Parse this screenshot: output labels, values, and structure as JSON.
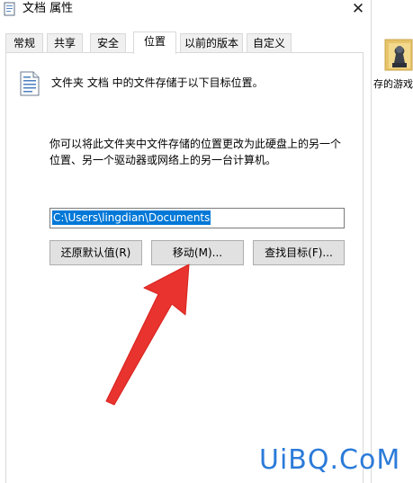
{
  "window": {
    "title": "文档 属性",
    "close_glyph": "✕"
  },
  "tabs": [
    {
      "label": "常规",
      "active": false
    },
    {
      "label": "共享",
      "active": false
    },
    {
      "label": "安全",
      "active": false
    },
    {
      "label": "位置",
      "active": true
    },
    {
      "label": "以前的版本",
      "active": false
    },
    {
      "label": "自定义",
      "active": false
    }
  ],
  "location_panel": {
    "heading": "文件夹 文档 中的文件存储于以下目标位置。",
    "description_lines": [
      "你可以将此文件夹中文件存储的位置更改为此硬盘上的另一个",
      "位置、另一个驱动器或网络上的另一台计算机。"
    ],
    "path_value": "C:\\Users\\lingdian\\Documents",
    "buttons": {
      "restore_default": "还原默认值(R)",
      "move": "移动(M)...",
      "find_target": "查找目标(F)..."
    }
  },
  "desktop": {
    "icon_label": "存的游戏"
  },
  "icons": {
    "title": "folder-document-icon",
    "close": "close-icon",
    "heading": "document-icon",
    "desktop": "saved-games-folder-icon"
  },
  "colors": {
    "selection": "#0078d7",
    "annotation_arrow": "#e8332e",
    "watermark": "#2b7bd9"
  },
  "watermark": "UiBQ.CoM"
}
